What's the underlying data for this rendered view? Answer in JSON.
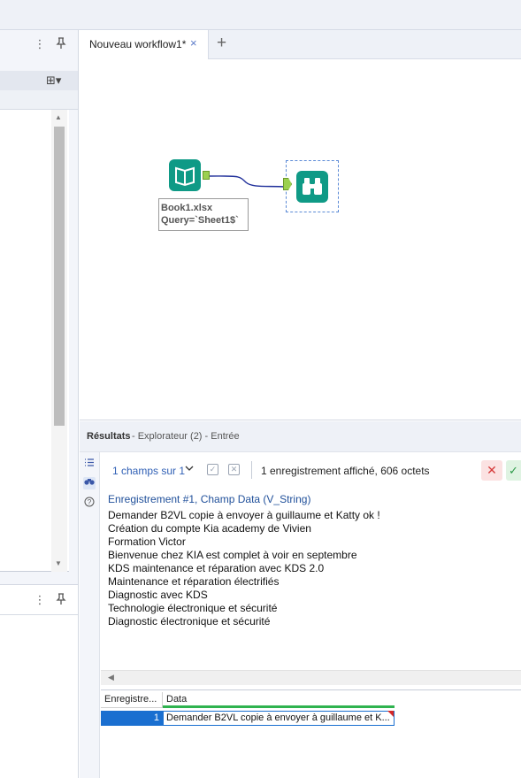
{
  "left_panel": {
    "more_icon": "⋮",
    "pin_icon": "pin-icon",
    "add_icon": "⊞▾"
  },
  "tabs": {
    "active_label": "Nouveau workflow1*",
    "close_glyph": "×",
    "add_glyph": "+"
  },
  "canvas": {
    "annotation_line1": "Book1.xlsx",
    "annotation_line2": "Query=`Sheet1$`",
    "input_tool_icon": "book-icon",
    "browse_tool_icon": "binoculars-icon",
    "tool_color": "#0f9a86",
    "connection_color": "#1f2f9a"
  },
  "results": {
    "title": "Résultats",
    "subtitle": "- Explorateur (2) - Entrée",
    "fields_label": "1 champs sur 1",
    "record_info": "1 enregistrement affiché, 606 octets",
    "cancel_glyph": "✕",
    "ok_glyph": "✓",
    "record_header": "Enregistrement #1, Champ Data (V_String)",
    "record_lines": [
      "Demander B2VL copie à envoyer à guillaume et Katty ok !",
      "Création du compte Kia academy de Vivien",
      "Formation Victor",
      "Bienvenue chez KIA est complet à voir en septembre",
      "KDS maintenance et réparation avec KDS 2.0",
      "Maintenance et réparation électrifiés",
      "Diagnostic avec KDS",
      "Technologie électronique et sécurité",
      "Diagnostic électronique et sécurité"
    ]
  },
  "grid": {
    "col_record": "Enregistre...",
    "col_data": "Data",
    "row_num": "1",
    "row_data": "Demander B2VL copie à envoyer à guillaume et K..."
  }
}
